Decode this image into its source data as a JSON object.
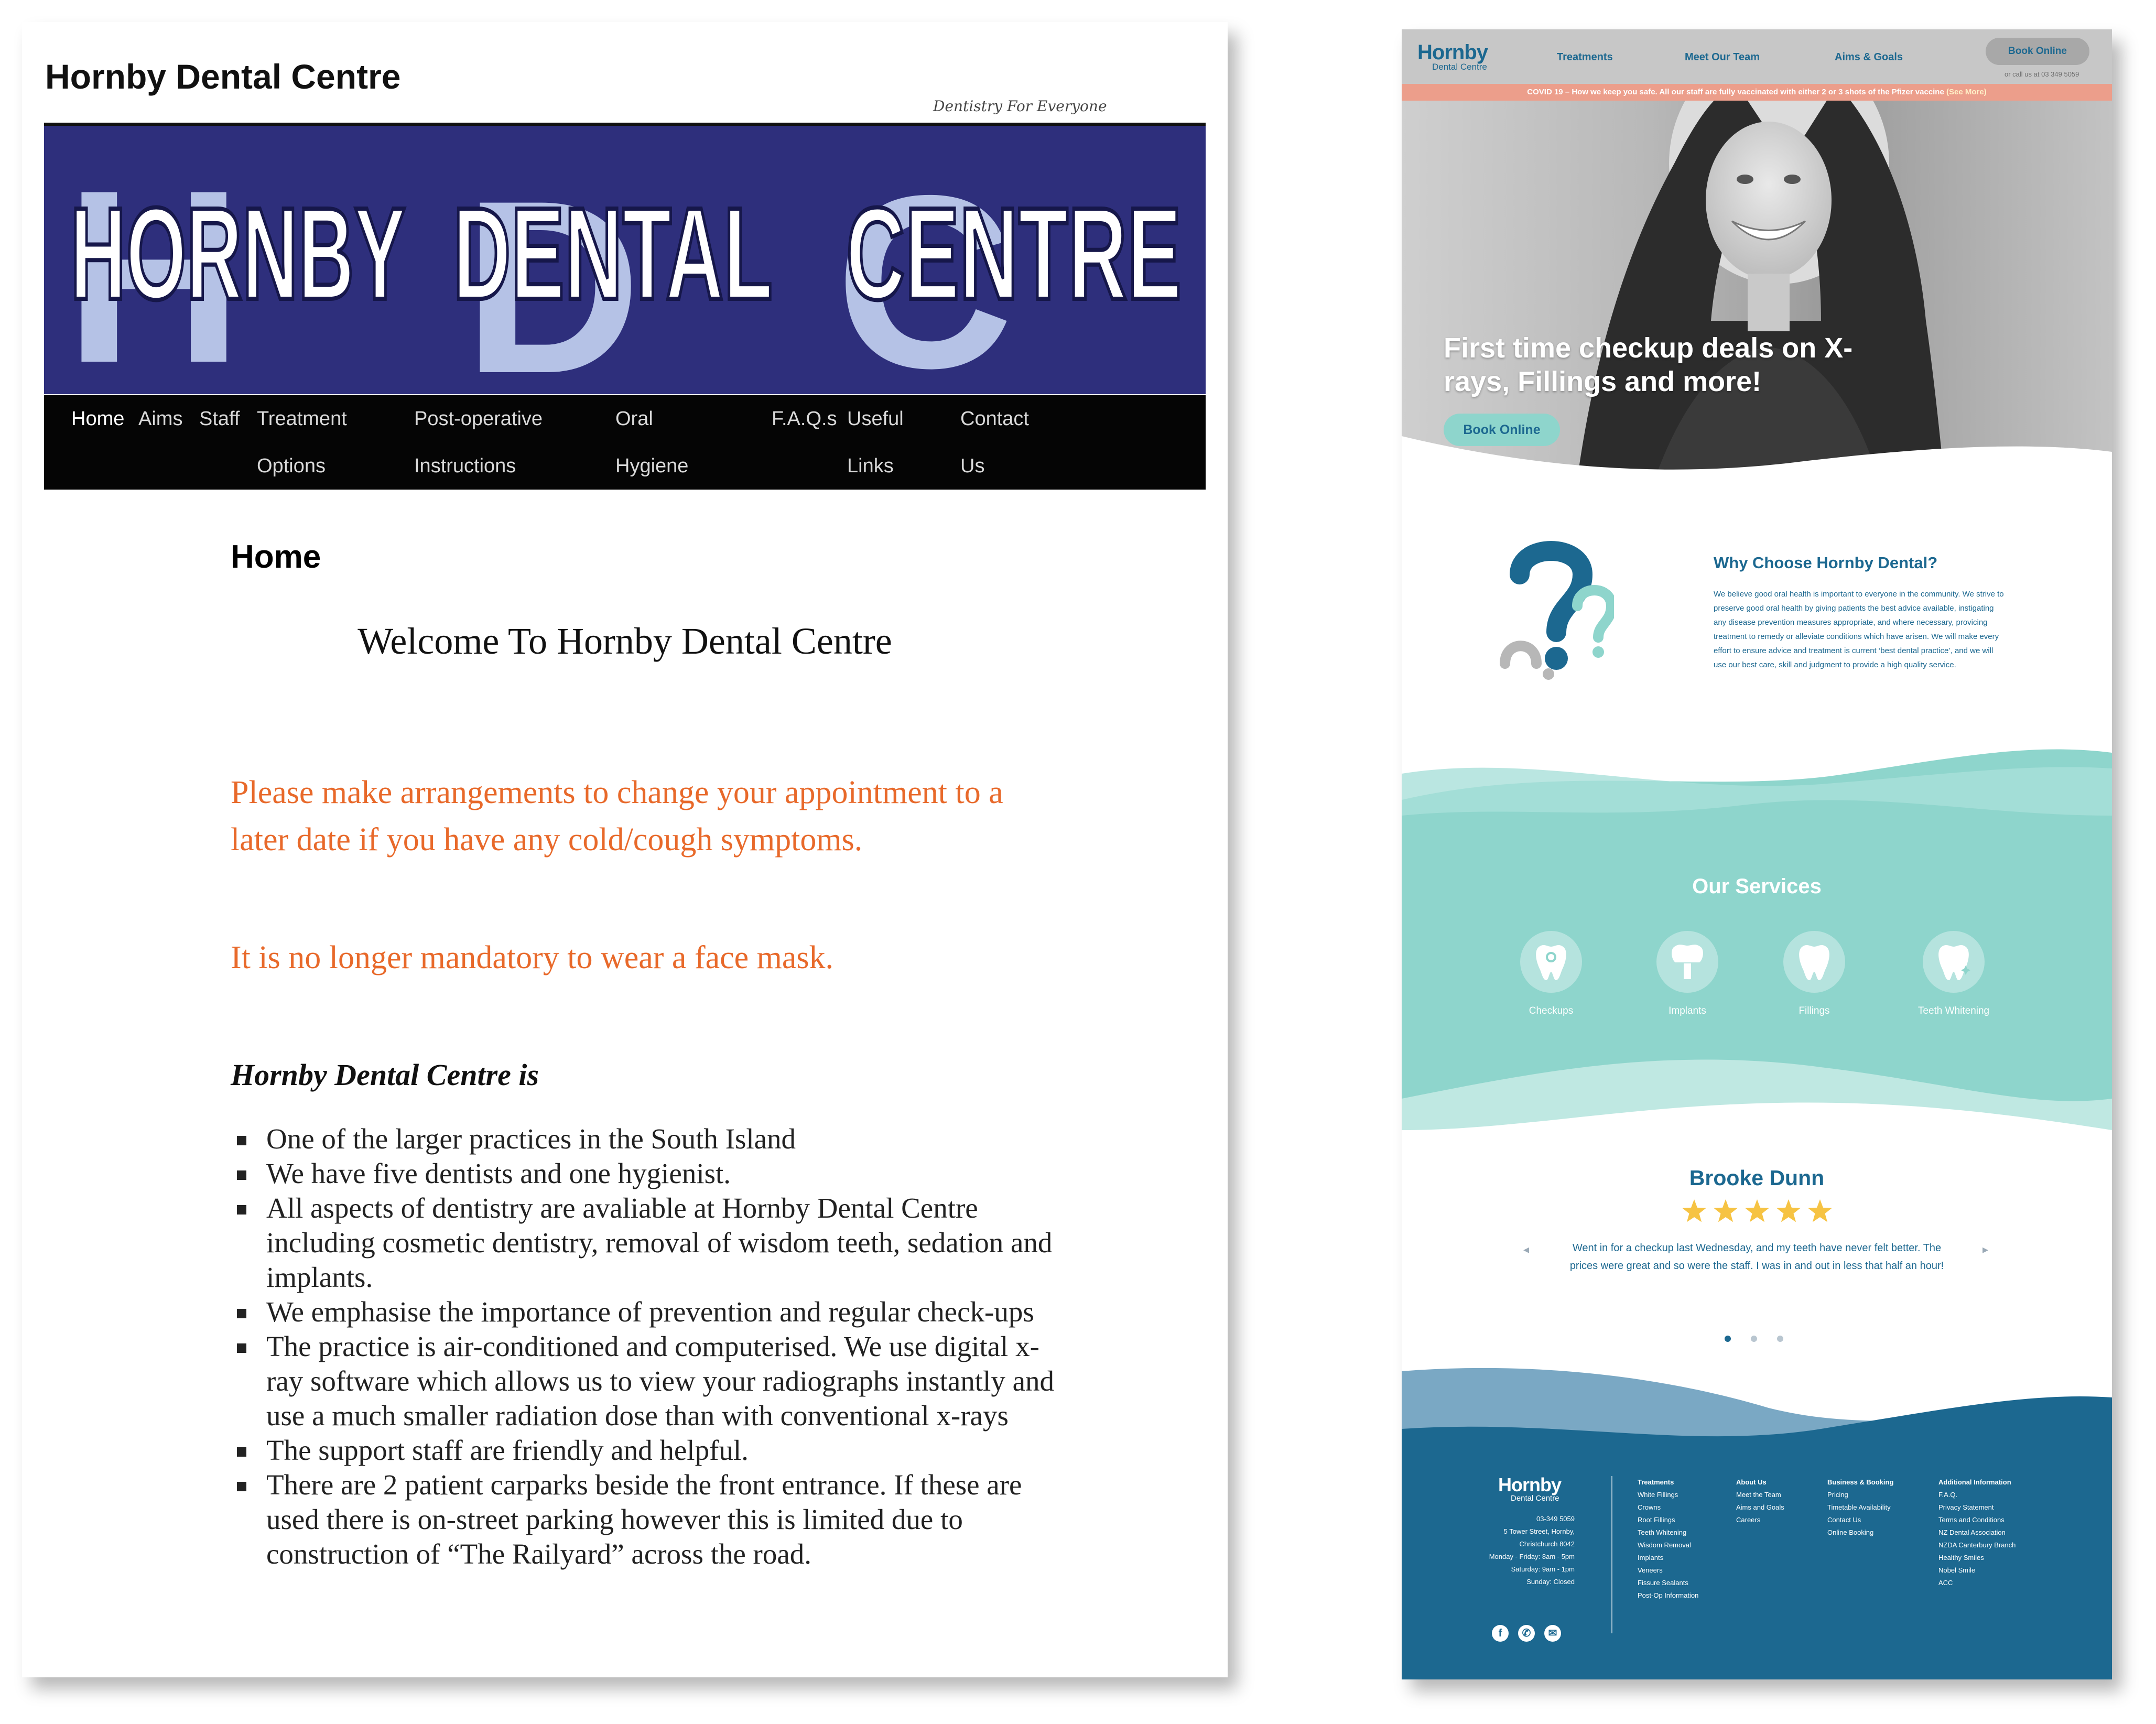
{
  "old_site": {
    "site_title": "Hornby Dental Centre",
    "tagline": "Dentistry For Everyone",
    "banner": {
      "word1": "HORNBY",
      "word2": "DENTAL",
      "word3": "CENTRE",
      "letter1": "H",
      "letter2": "D",
      "letter3": "C"
    },
    "nav": [
      {
        "line1": "Home",
        "line2": ""
      },
      {
        "line1": "Aims",
        "line2": ""
      },
      {
        "line1": "Staff",
        "line2": ""
      },
      {
        "line1": "Treatment",
        "line2": "Options"
      },
      {
        "line1": "Post-operative",
        "line2": "Instructions"
      },
      {
        "line1": "Oral",
        "line2": "Hygiene"
      },
      {
        "line1": "F.A.Q.s",
        "line2": ""
      },
      {
        "line1": "Useful",
        "line2": "Links"
      },
      {
        "line1": "Contact",
        "line2": "Us"
      }
    ],
    "page_heading": "Home",
    "welcome": "Welcome To Hornby Dental Centre",
    "notice_1": "Please make arrangements to change your appointment to a later date if you have any cold/cough symptoms.",
    "notice_2": "It is no longer mandatory to wear a face mask.",
    "is_heading": "Hornby Dental Centre is",
    "bullets": [
      "One of the larger practices in the South Island",
      "We have five dentists and one hygienist.",
      "All aspects of dentistry are avaliable at Hornby Dental Centre including cosmetic dentistry, removal of wisdom teeth, sedation and implants.",
      "We emphasise the importance of prevention and regular check-ups",
      "The practice is air-conditioned and computerised. We use digital x-ray software which allows us to view your radiographs instantly and use a much smaller radiation dose than with conventional x-rays",
      "The support staff are friendly and helpful.",
      "There are 2 patient carparks beside the front entrance. If these are used there is on-street  parking however this is limited due to construction of “The Railyard” across the road."
    ]
  },
  "new_site": {
    "logo": "Hornby",
    "logo_sub": "Dental Centre",
    "nav": [
      "Treatments",
      "Meet Our Team",
      "Aims & Goals"
    ],
    "book_button": "Book Online",
    "call_text": "or call us at 03 349 5059",
    "covid_banner": "COVID 19 – How we keep you safe. All our staff are fully vaccinated with either 2 or 3 shots of the Pfizer vaccine",
    "covid_more": "(See More)",
    "hero_title": "First time checkup deals on X-rays, Fillings and more!",
    "hero_button": "Book Online",
    "why_title": "Why Choose Hornby Dental?",
    "why_text": "We believe good oral health is important to everyone in the community. We strive to preserve good oral health by giving patients the best advice available, instigating any disease prevention measures appropriate, and where necessary, provicing treatment to remedy or alleviate conditions which have arisen. We will make every effort to ensure advice and treatment is current ‘best dental practice’, and we will use our best care, skill and judgment to provide a high quality service.",
    "services_title": "Our Services",
    "services": [
      "Checkups",
      "Implants",
      "Fillings",
      "Teeth Whitening"
    ],
    "review": {
      "name": "Brooke Dunn",
      "stars": 5,
      "text": "Went in for a checkup last Wednesday, and my teeth have never felt better. The prices were great and so were the staff. I was in and out in less that half an hour!",
      "active_slide": 1,
      "slide_count": 3
    },
    "footer": {
      "logo": "Hornby",
      "logo_sub": "Dental Centre",
      "contact": [
        "03-349 5059",
        "5 Tower Street, Hornby,",
        "Christchurch 8042",
        "Monday - Friday: 8am - 5pm",
        "Saturday: 9am - 1pm",
        "Sunday: Closed"
      ],
      "columns": [
        {
          "heading": "Treatments",
          "links": [
            "White Fillings",
            "Crowns",
            "Root Fillings",
            "Teeth Whitening",
            "Wisdom Removal",
            "Implants",
            "Veneers",
            "Fissure Sealants",
            "Post-Op Information"
          ]
        },
        {
          "heading": "About Us",
          "links": [
            "Meet the Team",
            "Aims and Goals",
            "Careers"
          ]
        },
        {
          "heading": "Business & Booking",
          "links": [
            "Pricing",
            "Timetable Availability",
            "Contact Us",
            "Online Booking"
          ]
        },
        {
          "heading": "Additional Information",
          "links": [
            "F.A.Q.",
            "Privacy Statement",
            "Terms and Conditions",
            "NZ Dental Association",
            "NZDA Canterbury Branch",
            "Healthy Smiles",
            "Nobel Smile",
            "ACC"
          ]
        }
      ],
      "social_icons": [
        "facebook-icon",
        "phone-icon",
        "email-icon"
      ]
    },
    "colors": {
      "primary": "#1c6890",
      "teal": "#8ed5cc",
      "coral": "#ec9e8b",
      "star": "#f6c343"
    }
  }
}
